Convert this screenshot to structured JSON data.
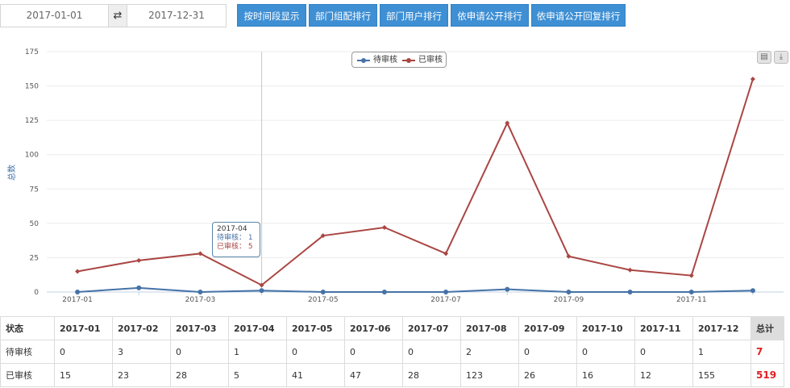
{
  "toolbar": {
    "start_date": "2017-01-01",
    "end_date": "2017-12-31",
    "swap_symbol": "⇄",
    "buttons": [
      "按时间段显示",
      "部门组配排行",
      "部门用户排行",
      "依申请公开排行",
      "依申请公开回复排行"
    ]
  },
  "colors": {
    "pending": "#4572a7",
    "reviewed": "#aa4643",
    "button": "#3e8fd4"
  },
  "chart_data": {
    "type": "line",
    "x": [
      "2017-01",
      "2017-02",
      "2017-03",
      "2017-04",
      "2017-05",
      "2017-06",
      "2017-07",
      "2017-08",
      "2017-09",
      "2017-10",
      "2017-11",
      "2017-12"
    ],
    "x_tick_labels": [
      "2017-01",
      "2017-03",
      "2017-05",
      "2017-07",
      "2017-09",
      "2017-11"
    ],
    "ylabel": "总数",
    "ylim": [
      0,
      175
    ],
    "y_ticks": [
      0,
      25,
      50,
      75,
      100,
      125,
      150,
      175
    ],
    "grid": true,
    "legend_position": "top-center",
    "series": [
      {
        "name": "待审核",
        "color": "#4572a7",
        "values": [
          0,
          3,
          0,
          1,
          0,
          0,
          0,
          2,
          0,
          0,
          0,
          1
        ]
      },
      {
        "name": "已审核",
        "color": "#aa4643",
        "values": [
          15,
          23,
          28,
          5,
          41,
          47,
          28,
          123,
          26,
          16,
          12,
          155
        ]
      }
    ],
    "tooltip": {
      "month": "2017-04",
      "lines": [
        "待审核： 1",
        "已审核： 5"
      ]
    }
  },
  "table": {
    "header_label": "状态",
    "months": [
      "2017-01",
      "2017-02",
      "2017-03",
      "2017-04",
      "2017-05",
      "2017-06",
      "2017-07",
      "2017-08",
      "2017-09",
      "2017-10",
      "2017-11",
      "2017-12"
    ],
    "total_label": "总计",
    "rows": [
      {
        "label": "待审核",
        "values": [
          "0",
          "3",
          "0",
          "1",
          "0",
          "0",
          "0",
          "2",
          "0",
          "0",
          "0",
          "1"
        ],
        "total": "7"
      },
      {
        "label": "已审核",
        "values": [
          "15",
          "23",
          "28",
          "5",
          "41",
          "47",
          "28",
          "123",
          "26",
          "16",
          "12",
          "155"
        ],
        "total": "519"
      }
    ]
  }
}
